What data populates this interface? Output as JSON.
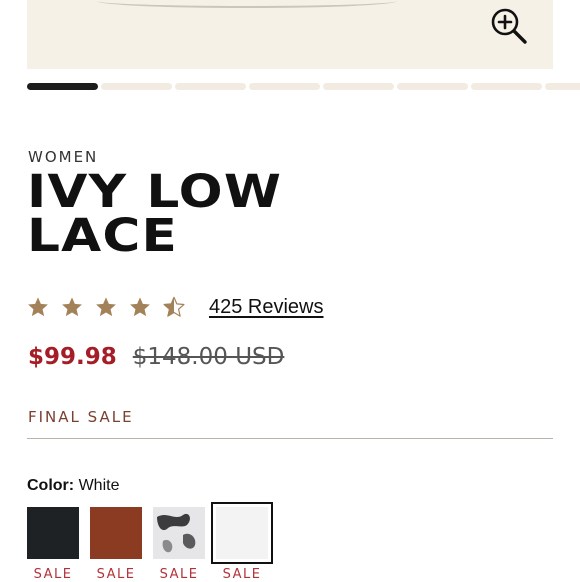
{
  "product": {
    "category": "WOMEN",
    "title_line1": "IVY LOW",
    "title_line2": "LACE",
    "rating": 4.5,
    "reviews_label": "425 Reviews",
    "sale_price": "$99.98",
    "original_price": "$148.00 USD",
    "final_sale_label": "FINAL SALE"
  },
  "gallery": {
    "current_index": 1,
    "total_images": 8
  },
  "color": {
    "label": "Color:",
    "selected": "White",
    "swatches": [
      {
        "name": "Black",
        "hex": "#1f2225",
        "badge": "SALE"
      },
      {
        "name": "Brown",
        "hex": "#8a3b22",
        "badge": "SALE"
      },
      {
        "name": "Print",
        "hex": "#e6e6e8",
        "badge": "SALE"
      },
      {
        "name": "White",
        "hex": "#f3f3f3",
        "badge": "SALE",
        "selected": true
      }
    ]
  },
  "icons": {
    "zoom": "zoom-in-icon",
    "star": "star-icon"
  },
  "colors": {
    "sale_red": "#a51d26",
    "star_gold": "#a48259",
    "final_sale_brown": "#7a4030"
  }
}
